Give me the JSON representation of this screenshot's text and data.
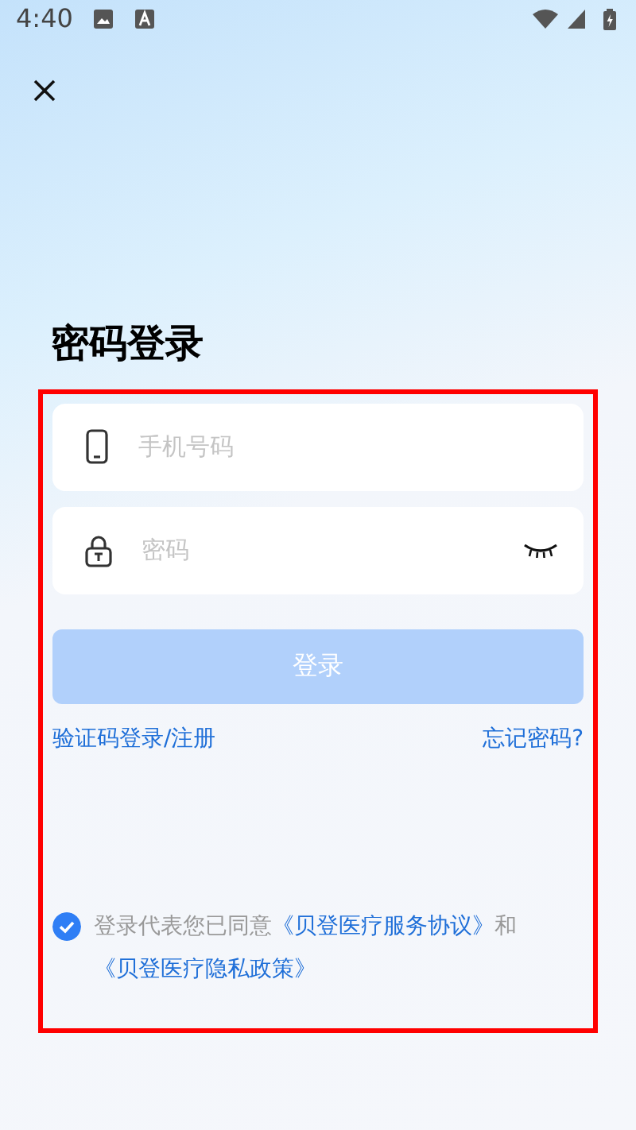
{
  "status_bar": {
    "time": "4:40"
  },
  "title": "密码登录",
  "fields": [
    {
      "kind": "phone",
      "placeholder": "手机号码"
    },
    {
      "kind": "password",
      "placeholder": "密码",
      "password_visible": false
    }
  ],
  "login_button": {
    "label": "登录",
    "disabled": true
  },
  "links": [
    "验证码登录/注册",
    "忘记密码?"
  ],
  "agreement": {
    "checked": true,
    "parts": [
      {
        "kind": "text",
        "text": "登录代表您已同意"
      },
      {
        "kind": "link",
        "text": "《贝登医疗服务协议》"
      },
      {
        "kind": "text",
        "text": "和"
      },
      {
        "kind": "link",
        "text": "《贝登医疗隐私政策》"
      }
    ]
  }
}
